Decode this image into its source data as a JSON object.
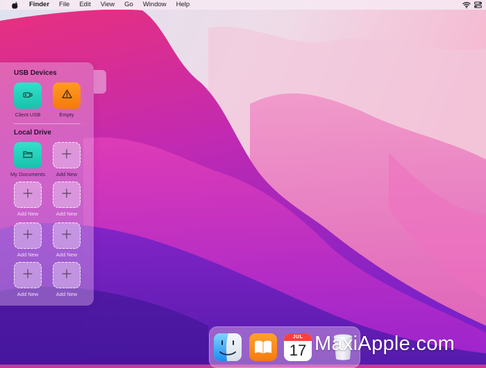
{
  "menubar": {
    "app_name": "Finder",
    "menus": [
      "File",
      "Edit",
      "View",
      "Go",
      "Window",
      "Help"
    ]
  },
  "panel": {
    "usb_section_title": "USB Devices",
    "usb_items": [
      {
        "label": "Client USB",
        "icon": "usb-drive-icon",
        "color": "#1fcfb8"
      },
      {
        "label": "Empty",
        "icon": "warning-icon",
        "color": "#f7860f"
      }
    ],
    "local_section_title": "Local Drive",
    "local_items": [
      {
        "label": "My Documents",
        "icon": "folder-icon",
        "color": "#1fcfb8"
      },
      {
        "label": "Add New",
        "icon": "plus-icon"
      },
      {
        "label": "Add New",
        "icon": "plus-icon"
      },
      {
        "label": "Add New",
        "icon": "plus-icon"
      },
      {
        "label": "Add New",
        "icon": "plus-icon"
      },
      {
        "label": "Add New",
        "icon": "plus-icon"
      },
      {
        "label": "Add New",
        "icon": "plus-icon"
      },
      {
        "label": "Add New",
        "icon": "plus-icon"
      }
    ]
  },
  "dock": {
    "apps": [
      {
        "name": "finder-icon"
      },
      {
        "name": "books-icon"
      },
      {
        "name": "calendar-icon",
        "month": "JUL",
        "day": "17"
      },
      {
        "name": "trash-icon"
      }
    ]
  },
  "watermark": "MaxiApple.com"
}
